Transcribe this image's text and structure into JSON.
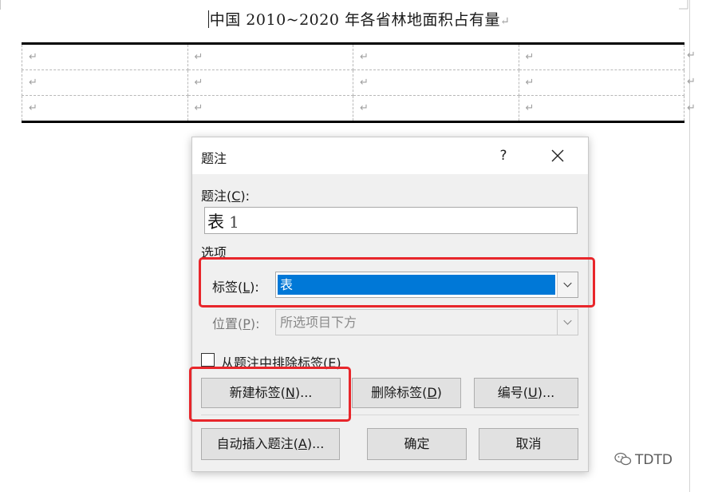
{
  "document": {
    "title": "中国 2010~2020 年各省林地面积占有量",
    "para_mark": "↵",
    "table": {
      "rows": [
        [
          "↵",
          "↵",
          "↵",
          "↵"
        ],
        [
          "↵",
          "↵",
          "↵",
          "↵"
        ],
        [
          "↵",
          "↵",
          "↵",
          "↵"
        ]
      ]
    }
  },
  "dialog": {
    "title": "题注",
    "help_glyph": "?",
    "caption_label_pre": "题注(",
    "caption_label_key": "C",
    "caption_label_post": "):",
    "caption_value_label": "表",
    "caption_value_number": "1",
    "options_label": "选项",
    "tag_label_pre": "标签(",
    "tag_label_key": "L",
    "tag_label_post": "):",
    "tag_value": "表",
    "position_label_pre": "位置(",
    "position_label_key": "P",
    "position_label_post": "):",
    "position_value": "所选项目下方",
    "exclude_label_pre": "从题注中排除标签(",
    "exclude_label_key": "E",
    "exclude_label_post": ")",
    "exclude_checked": false,
    "buttons": {
      "new_label_pre": "新建标签(",
      "new_label_key": "N",
      "new_label_post": ")...",
      "delete_label_pre": "删除标签(",
      "delete_label_key": "D",
      "delete_label_post": ")",
      "numbering_pre": "编号(",
      "numbering_key": "U",
      "numbering_post": ")...",
      "autocaption_pre": "自动插入题注(",
      "autocaption_key": "A",
      "autocaption_post": ")...",
      "ok": "确定",
      "cancel": "取消"
    }
  },
  "watermark": {
    "text": "TDTD"
  },
  "colors": {
    "highlight": "#e8262b",
    "selection": "#0078d7"
  }
}
